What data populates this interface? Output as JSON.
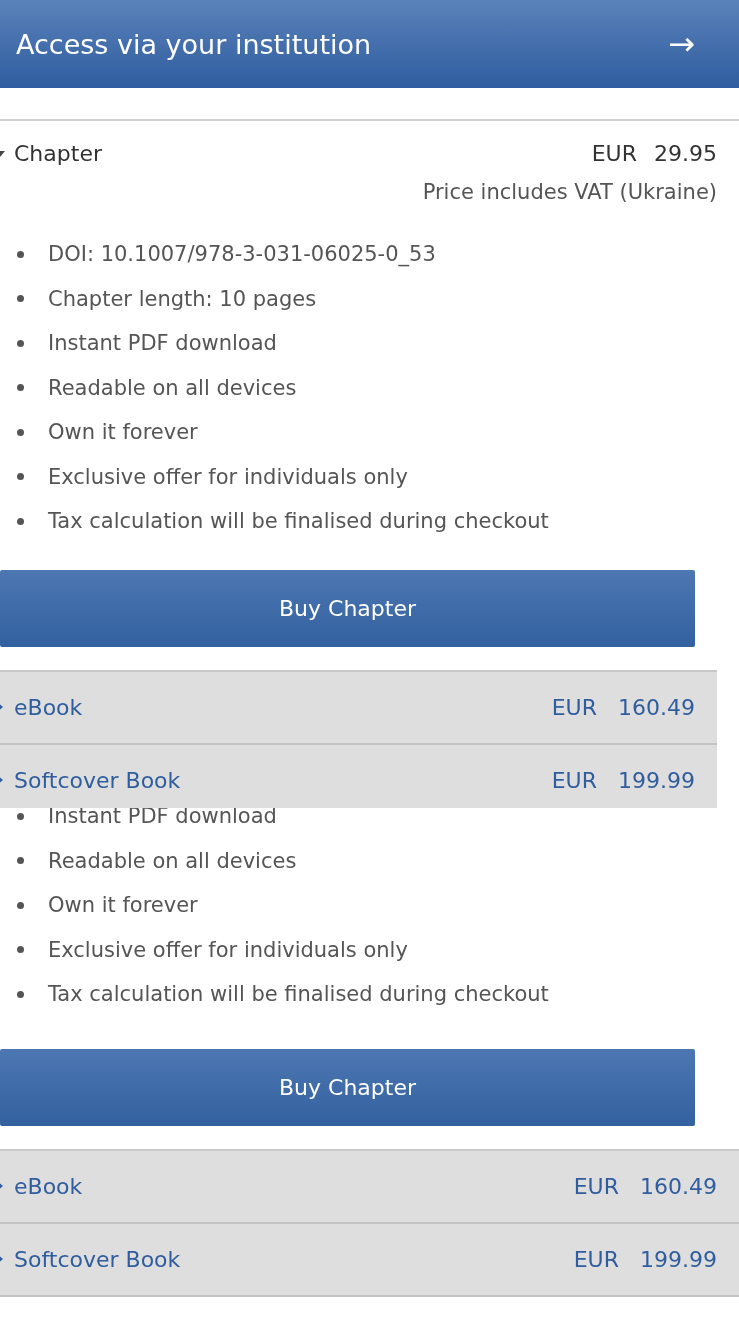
{
  "header": {
    "title": "Access via your institution",
    "arrow": "→"
  },
  "views": [
    {
      "chapter": {
        "label": "Chapter",
        "expanded": true,
        "currency": "EUR",
        "price": "29.95",
        "vat_note": "Price includes VAT (Ukraine)"
      },
      "features": [
        "DOI: 10.1007/978-3-031-06025-0_53",
        "Chapter length: 10 pages",
        "Instant PDF download",
        "Readable on all devices",
        "Own it forever",
        "Exclusive offer for individuals only",
        "Tax calculation will be finalised during checkout"
      ],
      "buy_button": "Buy Chapter",
      "formats": [
        {
          "label": "eBook",
          "expanded": false,
          "currency": "EUR",
          "price": "160.49"
        },
        {
          "label": "Softcover Book",
          "expanded": false,
          "currency": "EUR",
          "price": "199.99"
        }
      ]
    },
    {
      "features": [
        "Instant PDF download",
        "Readable on all devices",
        "Own it forever",
        "Exclusive offer for individuals only",
        "Tax calculation will be finalised during checkout"
      ],
      "buy_button": "Buy Chapter",
      "formats": [
        {
          "label": "eBook",
          "expanded": false,
          "currency": "EUR",
          "price": "160.49"
        },
        {
          "label": "Softcover Book",
          "expanded": false,
          "currency": "EUR",
          "price": "199.99"
        }
      ]
    }
  ]
}
